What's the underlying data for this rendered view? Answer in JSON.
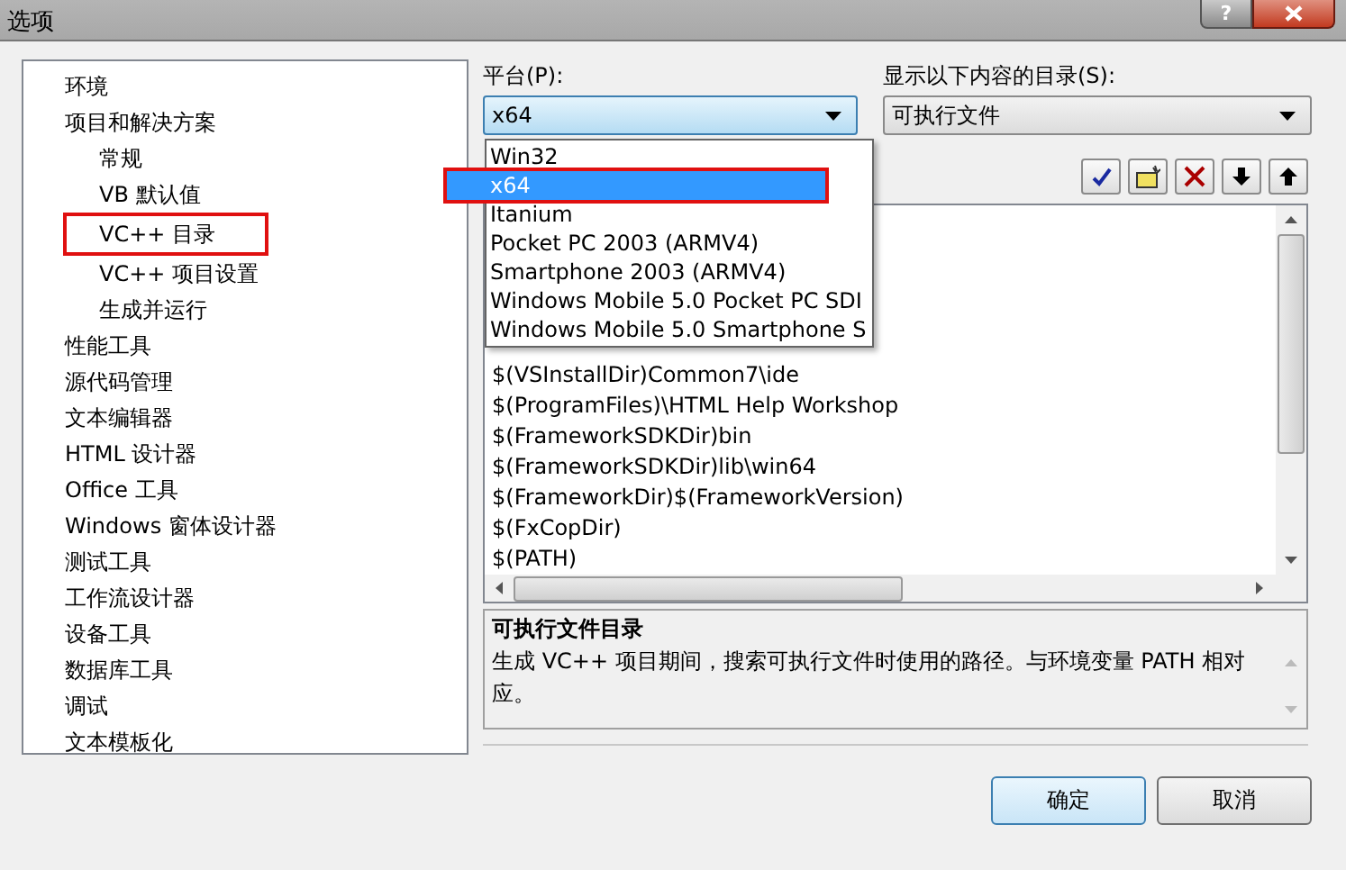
{
  "window": {
    "title": "选项",
    "help_glyph": "?"
  },
  "tree": [
    {
      "label": "环境",
      "selected": false
    },
    {
      "label": "项目和解决方案",
      "selected": false,
      "children": [
        {
          "label": "常规",
          "selected": false
        },
        {
          "label": "VB 默认值",
          "selected": false
        },
        {
          "label": "VC++ 目录",
          "selected": true
        },
        {
          "label": "VC++ 项目设置",
          "selected": false
        },
        {
          "label": "生成并运行",
          "selected": false
        }
      ]
    },
    {
      "label": "性能工具",
      "selected": false
    },
    {
      "label": "源代码管理",
      "selected": false
    },
    {
      "label": "文本编辑器",
      "selected": false
    },
    {
      "label": "HTML 设计器",
      "selected": false
    },
    {
      "label": "Office 工具",
      "selected": false
    },
    {
      "label": "Windows 窗体设计器",
      "selected": false
    },
    {
      "label": "测试工具",
      "selected": false
    },
    {
      "label": "工作流设计器",
      "selected": false
    },
    {
      "label": "设备工具",
      "selected": false
    },
    {
      "label": "数据库工具",
      "selected": false
    },
    {
      "label": "调试",
      "selected": false
    },
    {
      "label": "文本模板化",
      "selected": false
    }
  ],
  "platform": {
    "label": "平台(P):",
    "value": "x64",
    "options": [
      {
        "label": "Win32",
        "selected": false
      },
      {
        "label": "x64",
        "selected": true
      },
      {
        "label": "Itanium",
        "selected": false
      },
      {
        "label": "Pocket PC 2003 (ARMV4)",
        "selected": false
      },
      {
        "label": "Smartphone 2003 (ARMV4)",
        "selected": false
      },
      {
        "label": "Windows Mobile 5.0 Pocket PC SDI",
        "selected": false
      },
      {
        "label": "Windows Mobile 5.0 Smartphone S",
        "selected": false
      }
    ]
  },
  "directories_for": {
    "label": "显示以下内容的目录(S):",
    "value": "可执行文件"
  },
  "paths": [
    "$(VSInstallDir)Common7\\ide",
    "$(ProgramFiles)\\HTML Help Workshop",
    "$(FrameworkSDKDir)bin",
    "$(FrameworkSDKDir)lib\\win64",
    "$(FrameworkDir)$(FrameworkVersion)",
    "$(FxCopDir)",
    "$(PATH)"
  ],
  "description": {
    "title": "可执行文件目录",
    "text": "生成 VC++ 项目期间，搜索可执行文件时使用的路径。与环境变量 PATH 相对应。"
  },
  "buttons": [
    {
      "label": "确定",
      "kind": "default"
    },
    {
      "label": "取消",
      "kind": "normal"
    }
  ]
}
